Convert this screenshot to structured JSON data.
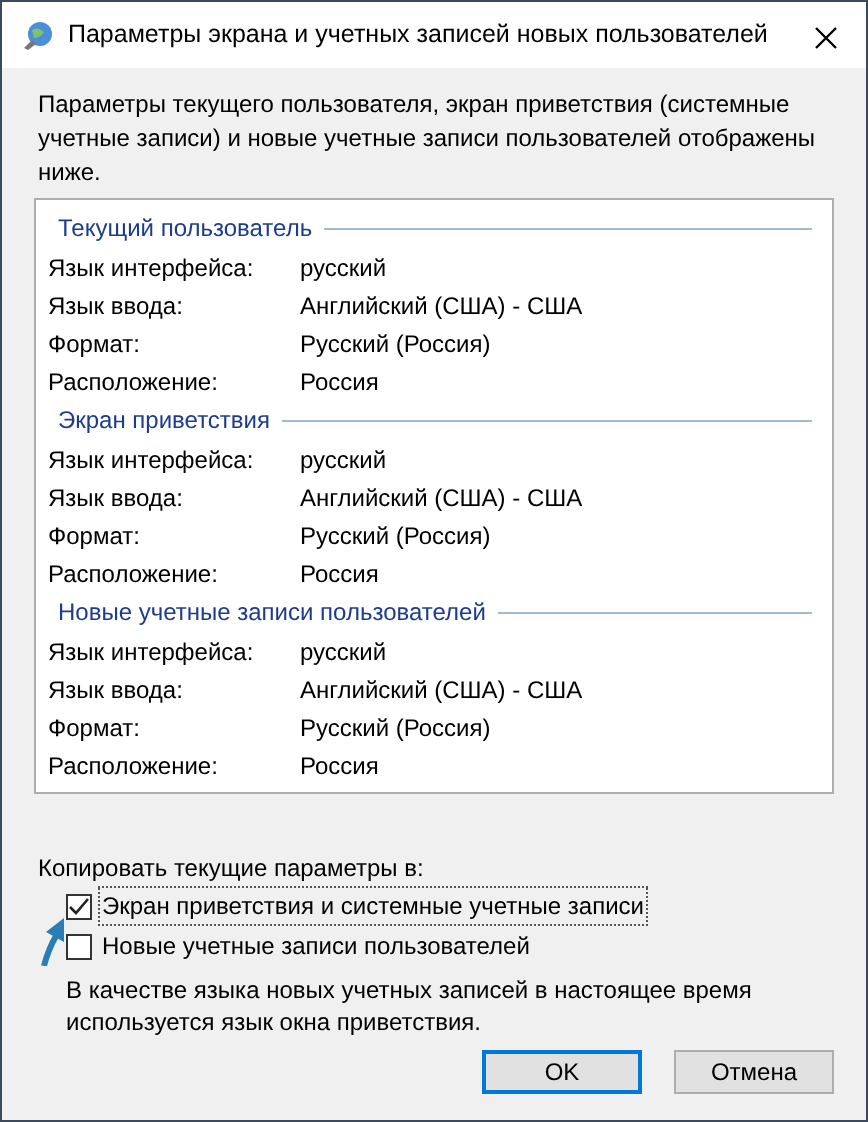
{
  "window": {
    "title": "Параметры экрана и учетных записей новых пользователей"
  },
  "intro": "Параметры текущего пользователя, экран приветствия (системные учетные записи) и новые учетные записи пользователей отображены ниже.",
  "sections": [
    {
      "title": "Текущий пользователь",
      "rows": [
        {
          "label": "Язык интерфейса:",
          "value": "русский"
        },
        {
          "label": "Язык ввода:",
          "value": "Английский (США) - США"
        },
        {
          "label": "Формат:",
          "value": "Русский (Россия)"
        },
        {
          "label": "Расположение:",
          "value": "Россия"
        }
      ]
    },
    {
      "title": "Экран приветствия",
      "rows": [
        {
          "label": "Язык интерфейса:",
          "value": "русский"
        },
        {
          "label": "Язык ввода:",
          "value": "Английский (США) - США"
        },
        {
          "label": "Формат:",
          "value": "Русский (Россия)"
        },
        {
          "label": "Расположение:",
          "value": "Россия"
        }
      ]
    },
    {
      "title": "Новые учетные записи пользователей",
      "rows": [
        {
          "label": "Язык интерфейса:",
          "value": "русский"
        },
        {
          "label": "Язык ввода:",
          "value": "Английский (США) - США"
        },
        {
          "label": "Формат:",
          "value": "Русский (Россия)"
        },
        {
          "label": "Расположение:",
          "value": "Россия"
        }
      ]
    }
  ],
  "copy_label": "Копировать текущие параметры в:",
  "checkboxes": [
    {
      "label": "Экран приветствия и системные учетные записи",
      "checked": true,
      "focused": true
    },
    {
      "label": "Новые учетные записи пользователей",
      "checked": false,
      "focused": false
    }
  ],
  "note": "В качестве языка новых учетных записей в настоящее время используется язык окна приветствия.",
  "buttons": [
    {
      "label": "OK",
      "default": true
    },
    {
      "label": "Отмена",
      "default": false
    }
  ]
}
